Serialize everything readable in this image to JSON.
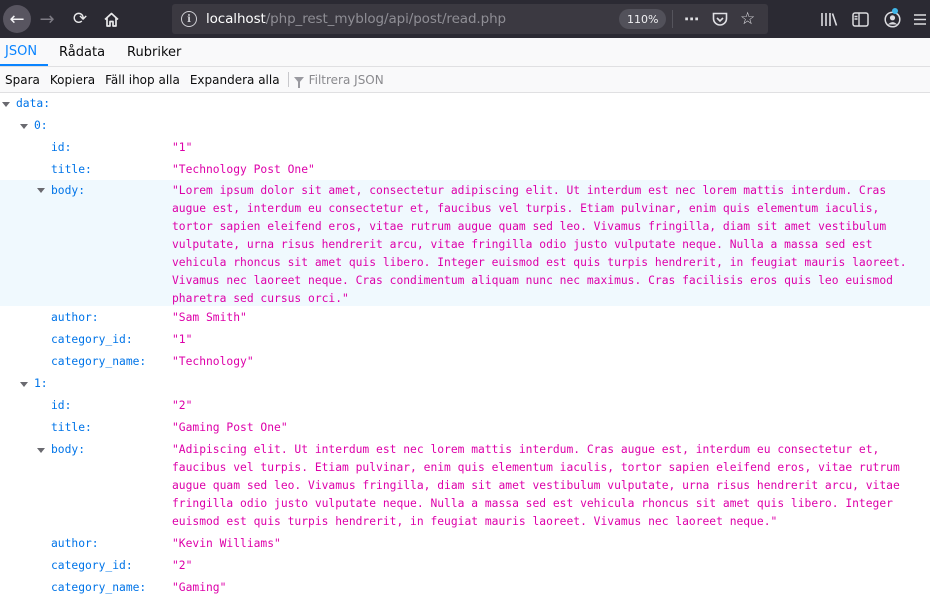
{
  "browser": {
    "url_host": "localhost",
    "url_path": "/php_rest_myblog/api/post/read.php",
    "zoom": "110%"
  },
  "viewer": {
    "tabs": [
      "JSON",
      "Rådata",
      "Rubriker"
    ],
    "active_tab": "JSON",
    "toolbar": {
      "save": "Spara",
      "copy": "Kopiera",
      "collapse_all": "Fäll ihop alla",
      "expand_all": "Expandera alla",
      "filter_placeholder": "Filtrera JSON"
    }
  },
  "json": {
    "root_key": "data:",
    "items": [
      {
        "index": "0:",
        "id": "\"1\"",
        "title": "\"Technology Post One\"",
        "body": "\"Lorem ipsum dolor sit amet, consectetur adipiscing elit. Ut interdum est nec lorem mattis interdum. Cras augue est, interdum eu consectetur et, faucibus vel turpis. Etiam pulvinar, enim quis elementum iaculis, tortor sapien eleifend eros, vitae rutrum augue quam sed leo. Vivamus fringilla, diam sit amet vestibulum vulputate, urna risus hendrerit arcu, vitae fringilla odio justo vulputate neque. Nulla a massa sed est vehicula rhoncus sit amet quis libero. Integer euismod est quis turpis hendrerit, in feugiat mauris laoreet. Vivamus nec laoreet neque. Cras condimentum aliquam nunc nec maximus. Cras facilisis eros quis leo euismod pharetra sed cursus orci.\"",
        "author": "\"Sam Smith\"",
        "category_id": "\"1\"",
        "category_name": "\"Technology\""
      },
      {
        "index": "1:",
        "id": "\"2\"",
        "title": "\"Gaming Post One\"",
        "body": "\"Adipiscing elit. Ut interdum est nec lorem mattis interdum. Cras augue est, interdum eu consectetur et, faucibus vel turpis. Etiam pulvinar, enim quis elementum iaculis, tortor sapien eleifend eros, vitae rutrum augue quam sed leo. Vivamus fringilla, diam sit amet vestibulum vulputate, urna risus hendrerit arcu, vitae fringilla odio justo vulputate neque. Nulla a massa sed est vehicula rhoncus sit amet quis libero. Integer euismod est quis turpis hendrerit, in feugiat mauris laoreet. Vivamus nec laoreet neque.\"",
        "author": "\"Kevin Williams\"",
        "category_id": "\"2\"",
        "category_name": "\"Gaming\""
      }
    ],
    "field_labels": {
      "id": "id:",
      "title": "title:",
      "body": "body:",
      "author": "author:",
      "category_id": "category_id:",
      "category_name": "category_name:"
    }
  },
  "icons": [
    "back-icon",
    "forward-icon",
    "reload-icon",
    "home-icon",
    "info-icon",
    "more-icon",
    "pocket-icon",
    "bookmark-star-icon",
    "library-icon",
    "sidebar-icon",
    "account-icon",
    "menu-icon",
    "filter-icon"
  ]
}
